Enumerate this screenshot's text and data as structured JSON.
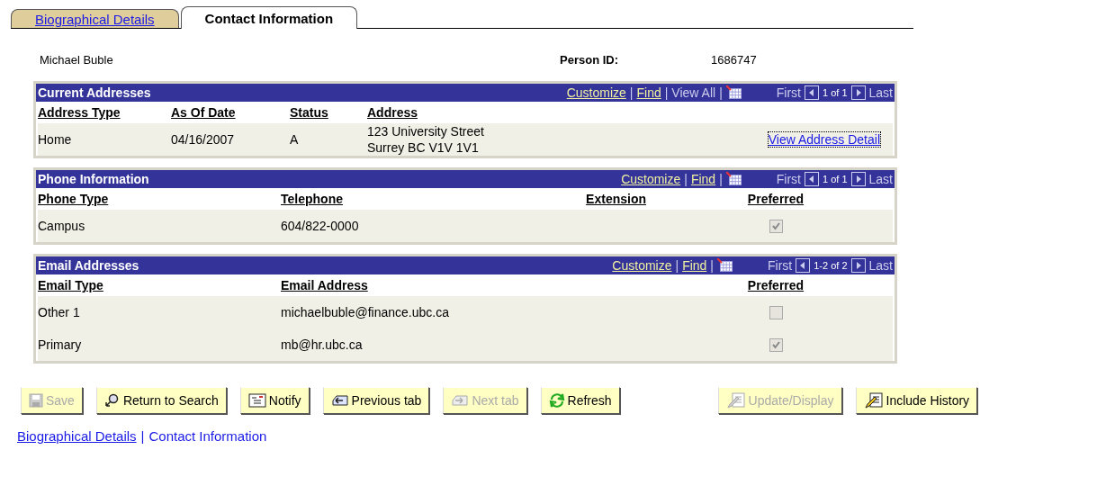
{
  "tabs": [
    {
      "label": "Biographical Details",
      "selected": false
    },
    {
      "label": "Contact Information",
      "selected": true
    }
  ],
  "person": {
    "name": "Michael Buble",
    "id_label": "Person ID:",
    "id_value": "1686747"
  },
  "sections": [
    {
      "title": "Current Addresses",
      "nav": [
        {
          "kind": "link",
          "label": "Customize"
        },
        {
          "kind": "separator",
          "label": "|"
        },
        {
          "kind": "link",
          "label": "Find"
        },
        {
          "kind": "separator",
          "label": "|"
        },
        {
          "kind": "text",
          "label": "View All"
        },
        {
          "kind": "separator",
          "label": "|"
        },
        {
          "kind": "grid"
        }
      ],
      "pager": {
        "first": "First",
        "range": "1 of 1",
        "last": "Last"
      },
      "columns": [
        "Address Type",
        "As Of Date",
        "Status",
        "Address"
      ],
      "rows": [
        {
          "cells": [
            {
              "kind": "text",
              "text": "Home"
            },
            {
              "kind": "text",
              "text": "04/16/2007"
            },
            {
              "kind": "text",
              "text": "A"
            },
            {
              "kind": "lines",
              "lines": [
                "123 University Street",
                "Surrey BC V1V 1V1"
              ]
            },
            {
              "kind": "link",
              "text": "View Address Detail"
            }
          ]
        }
      ]
    },
    {
      "title": "Phone Information",
      "nav": [
        {
          "kind": "link",
          "label": "Customize"
        },
        {
          "kind": "separator",
          "label": "|"
        },
        {
          "kind": "link",
          "label": "Find"
        },
        {
          "kind": "separator",
          "label": "|"
        },
        {
          "kind": "grid"
        }
      ],
      "pager": {
        "first": "First",
        "range": "1 of 1",
        "last": "Last"
      },
      "columns": [
        "Phone Type",
        "Telephone",
        "Extension",
        "Preferred"
      ],
      "rows": [
        {
          "cells": [
            {
              "kind": "text",
              "text": "Campus"
            },
            {
              "kind": "text",
              "text": "604/822-0000"
            },
            {
              "kind": "empty"
            },
            {
              "kind": "checkbox",
              "checked": true,
              "disabled": true
            }
          ]
        }
      ]
    },
    {
      "title": "Email Addresses",
      "nav": [
        {
          "kind": "link",
          "label": "Customize"
        },
        {
          "kind": "separator",
          "label": "|"
        },
        {
          "kind": "link",
          "label": "Find"
        },
        {
          "kind": "separator",
          "label": "|"
        },
        {
          "kind": "grid"
        }
      ],
      "pager": {
        "first": "First",
        "range": "1-2 of 2",
        "last": "Last"
      },
      "columns": [
        "Email Type",
        "Email Address",
        "Preferred"
      ],
      "rows": [
        {
          "cells": [
            {
              "kind": "text",
              "text": "Other 1"
            },
            {
              "kind": "text",
              "text": "michaelbuble@finance.ubc.ca"
            },
            {
              "kind": "checkbox",
              "checked": false,
              "disabled": true
            }
          ]
        },
        {
          "cells": [
            {
              "kind": "text",
              "text": "Primary"
            },
            {
              "kind": "text",
              "text": "mb@hr.ubc.ca"
            },
            {
              "kind": "checkbox",
              "checked": true,
              "disabled": true
            }
          ]
        }
      ]
    }
  ],
  "buttons_left": [
    {
      "label": "Save",
      "kind": "save",
      "disabled": true
    },
    {
      "label": "Return to Search",
      "kind": "search",
      "disabled": false
    },
    {
      "label": "Notify",
      "kind": "notify",
      "disabled": false
    },
    {
      "label": "Previous tab",
      "kind": "prev",
      "disabled": false
    },
    {
      "label": "Next tab",
      "kind": "next",
      "disabled": true
    },
    {
      "label": "Refresh",
      "kind": "refresh",
      "disabled": false
    }
  ],
  "buttons_right": [
    {
      "label": "Update/Display",
      "kind": "edit",
      "disabled": true
    },
    {
      "label": "Include History",
      "kind": "edit",
      "disabled": false
    }
  ],
  "footer": [
    {
      "kind": "link",
      "label": "Biographical Details"
    },
    {
      "kind": "separator",
      "label": "|"
    },
    {
      "kind": "current",
      "label": "Contact Information"
    }
  ]
}
